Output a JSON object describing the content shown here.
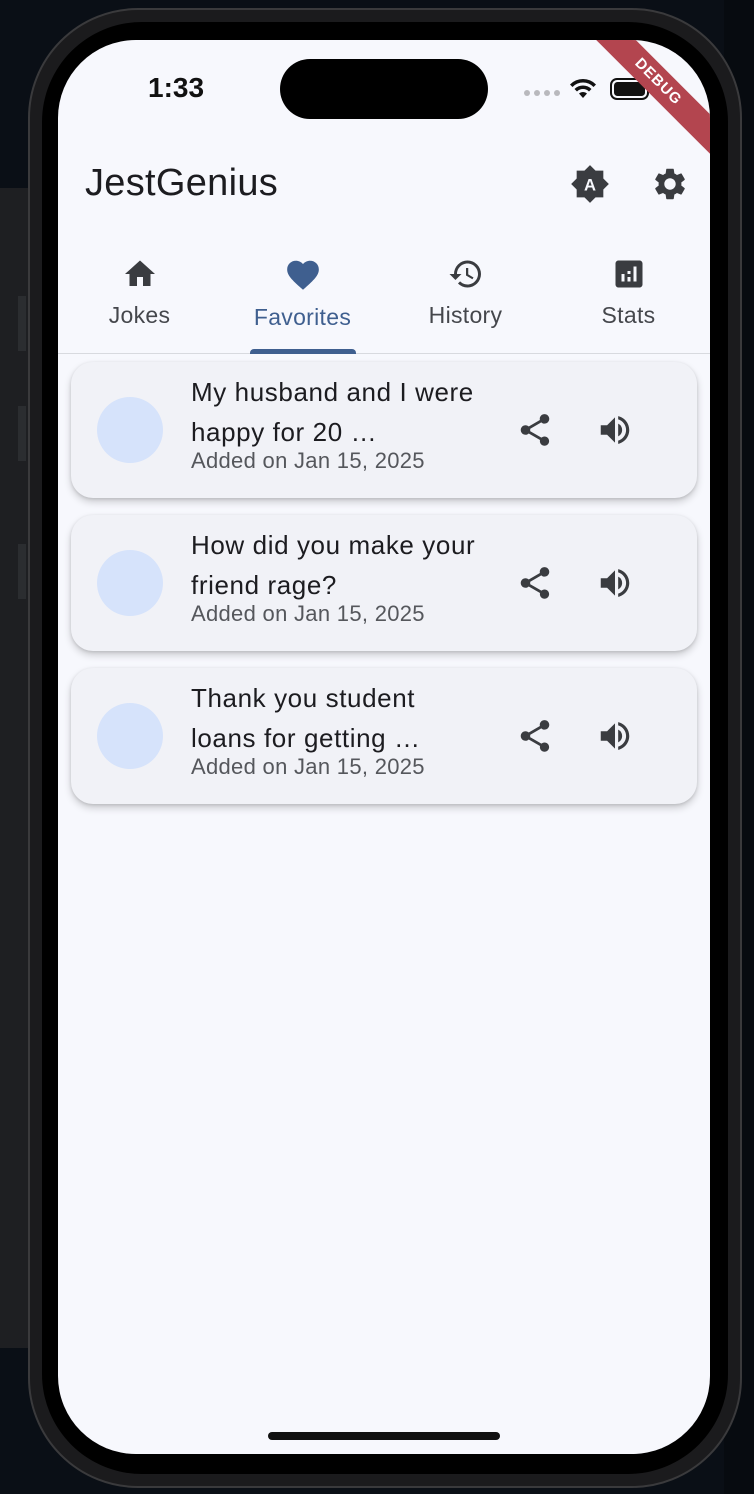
{
  "status_bar": {
    "time": "1:33"
  },
  "debug_banner": "DEBUG",
  "app_bar": {
    "title": "JestGenius",
    "theme_icon": "brightness-auto-icon",
    "settings_icon": "gear-icon"
  },
  "tabs": [
    {
      "label": "Jokes",
      "icon": "home-icon",
      "active": false
    },
    {
      "label": "Favorites",
      "icon": "heart-icon",
      "active": true
    },
    {
      "label": "History",
      "icon": "history-icon",
      "active": false
    },
    {
      "label": "Stats",
      "icon": "bar-chart-icon",
      "active": false
    }
  ],
  "favorites": [
    {
      "title": "My husband and I were happy for 20 …",
      "date": "Added on Jan 15, 2025"
    },
    {
      "title": "How did you make your friend rage?",
      "date": "Added on Jan 15, 2025"
    },
    {
      "title": "Thank you student loans for getting …",
      "date": "Added on Jan 15, 2025"
    }
  ],
  "colors": {
    "accent": "#3f5f8f",
    "background": "#f7f8fd",
    "card": "#f1f2f7",
    "avatar": "#d6e3fb",
    "debug": "#b3454f"
  }
}
